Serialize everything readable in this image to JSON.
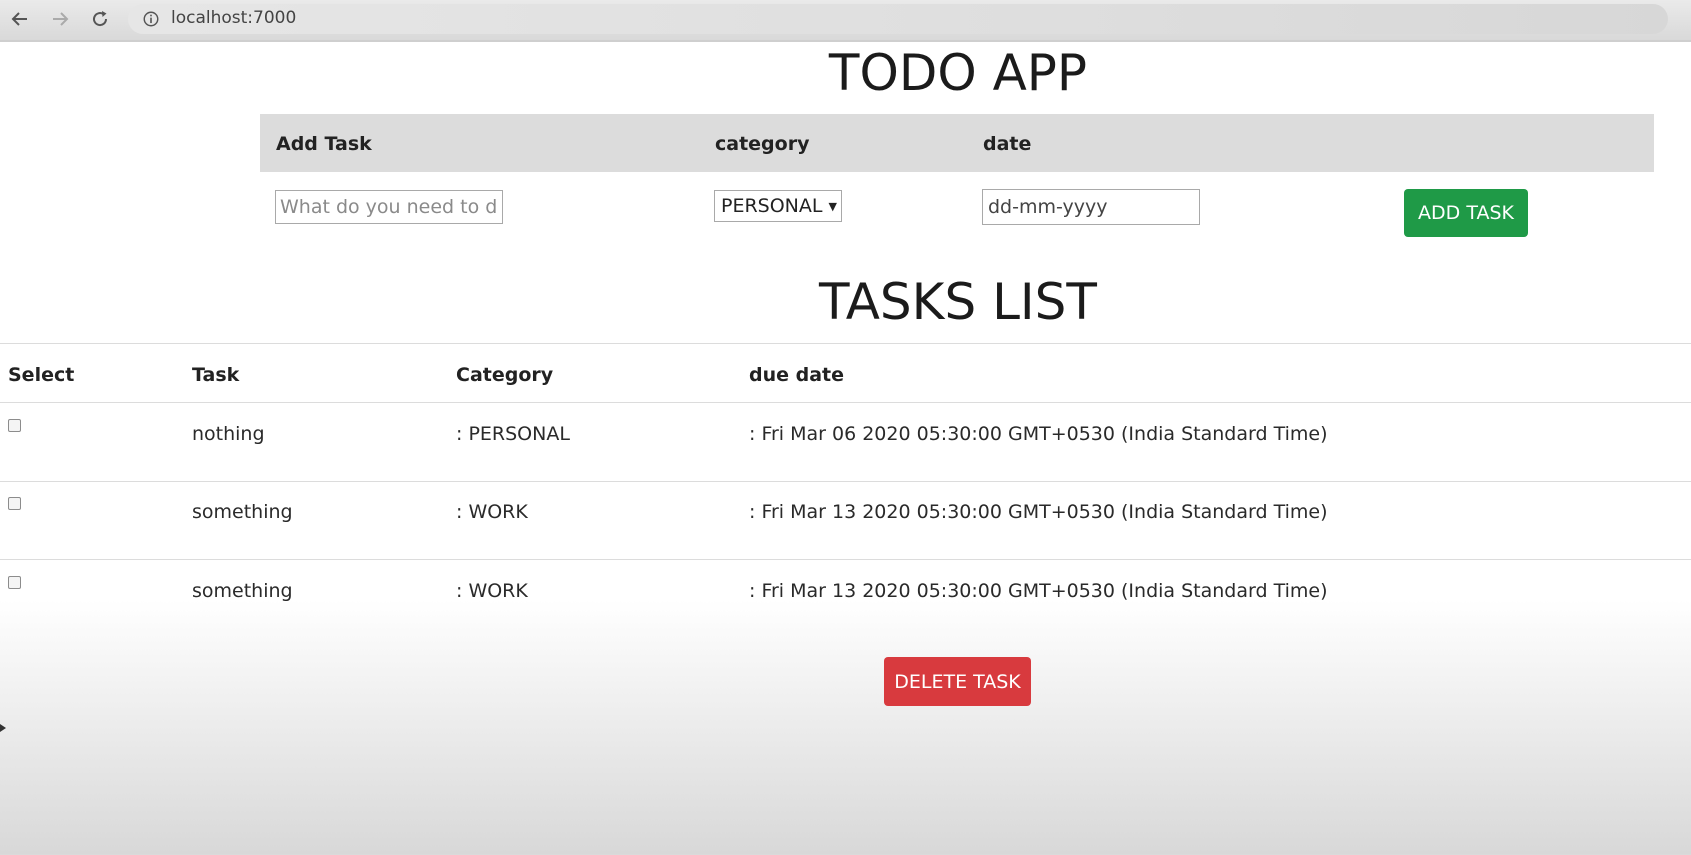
{
  "browser": {
    "url": "localhost:7000"
  },
  "page": {
    "title": "TODO APP",
    "tasks_heading": "TASKS LIST"
  },
  "add_form": {
    "headers": {
      "task": "Add Task",
      "category": "category",
      "date": "date"
    },
    "task_placeholder": "What do you need to do?",
    "category_selected": "PERSONAL",
    "date_placeholder": "dd-mm-yyyy",
    "add_button": "ADD TASK"
  },
  "table": {
    "headers": {
      "select": "Select",
      "task": "Task",
      "category": "Category",
      "due_date": "due date"
    },
    "rows": [
      {
        "task": "nothing",
        "category": ": PERSONAL",
        "due": ": Fri Mar 06 2020 05:30:00 GMT+0530 (India Standard Time)",
        "checked": false
      },
      {
        "task": "something",
        "category": ": WORK",
        "due": ": Fri Mar 13 2020 05:30:00 GMT+0530 (India Standard Time)",
        "checked": false
      },
      {
        "task": "something",
        "category": ": WORK",
        "due": ": Fri Mar 13 2020 05:30:00 GMT+0530 (India Standard Time)",
        "checked": false
      }
    ]
  },
  "delete_button": "DELETE TASK",
  "colors": {
    "add_button": "#1f9a47",
    "delete_button": "#d83a3e",
    "form_header_bg": "#dcdcdc"
  }
}
